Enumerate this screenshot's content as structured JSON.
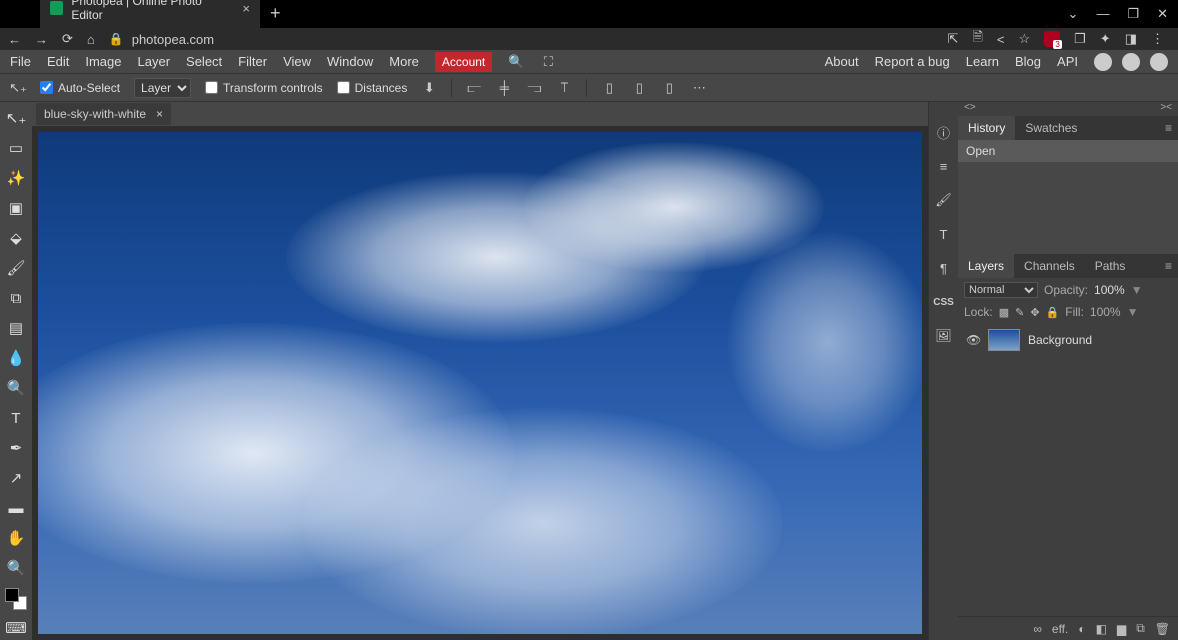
{
  "browser": {
    "tab_title": "Photopea | Online Photo Editor",
    "url": "photopea.com",
    "new_tab": "+"
  },
  "menu": {
    "file": "File",
    "edit": "Edit",
    "image": "Image",
    "layer": "Layer",
    "select": "Select",
    "filter": "Filter",
    "view": "View",
    "window": "Window",
    "more": "More",
    "account": "Account",
    "about": "About",
    "report": "Report a bug",
    "learn": "Learn",
    "blog": "Blog",
    "api": "API"
  },
  "options": {
    "auto_select": "Auto-Select",
    "layer_select": "Layer",
    "transform": "Transform controls",
    "distances": "Distances"
  },
  "document": {
    "tab_name": "blue-sky-with-white"
  },
  "right_tabs": {
    "css": "CSS"
  },
  "history": {
    "tab": "History",
    "swatches": "Swatches",
    "item": "Open"
  },
  "layers": {
    "tab": "Layers",
    "channels": "Channels",
    "paths": "Paths",
    "blend": "Normal",
    "opacity_label": "Opacity:",
    "opacity": "100%",
    "lock": "Lock:",
    "fill_label": "Fill:",
    "fill": "100%",
    "bgname": "Background",
    "foot_eff": "eff."
  }
}
